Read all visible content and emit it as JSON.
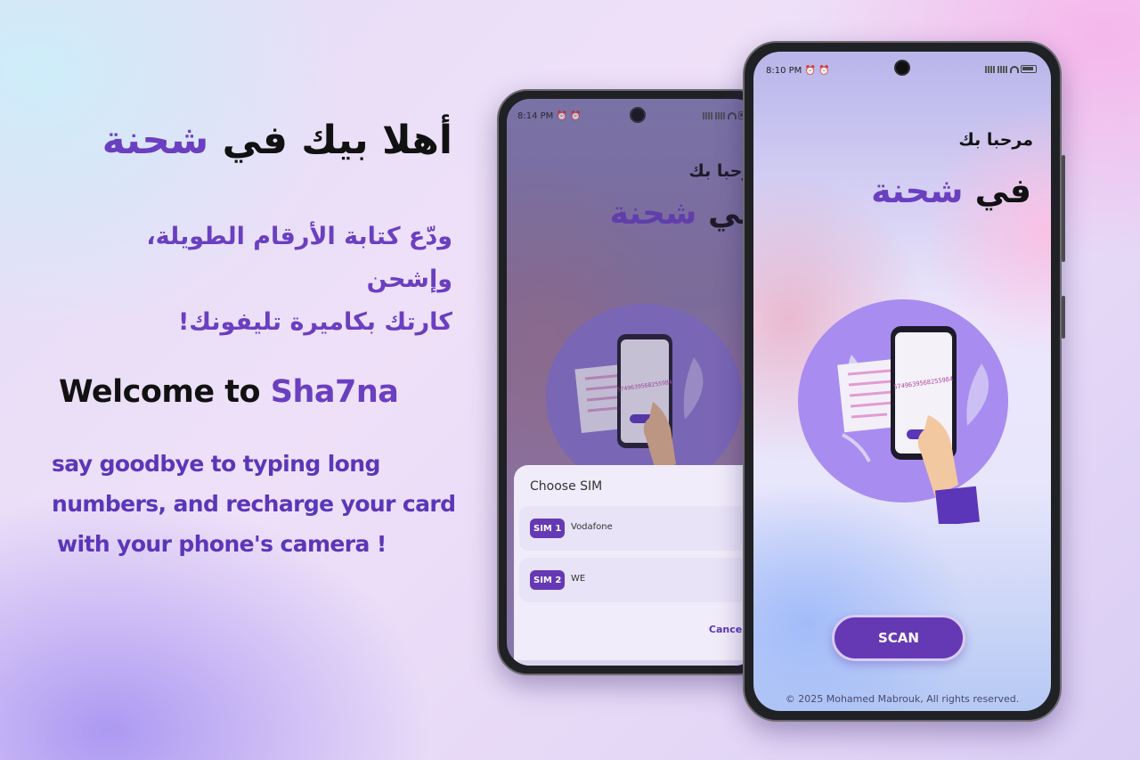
{
  "headline_ar": {
    "part1": "أهلا بيك في",
    "part2": "شحنة"
  },
  "subtitle_ar": {
    "line1": "ودّع كتابة الأرقام الطويلة، وإشحن",
    "line2": "كارتك بكاميرة تليفونك!"
  },
  "headline_en": {
    "part1": "Welcome to",
    "part2": "Sha7na"
  },
  "subtitle_en": {
    "line1": "say goodbye to typing long",
    "line2": "numbers, and recharge your card",
    "line3": "with your phone's camera !"
  },
  "back_phone": {
    "status_time": "8:14 PM",
    "welcome_line1": "مرحبا بك",
    "welcome_line2_prefix": "في",
    "welcome_line2_brand": "شحنة",
    "card_number": "5749639568255984",
    "sheet": {
      "title": "Choose SIM",
      "sims": [
        {
          "badge": "SIM 1",
          "name": "Vodafone"
        },
        {
          "badge": "SIM 2",
          "name": "WE"
        }
      ],
      "cancel_label": "Cancel"
    }
  },
  "front_phone": {
    "status_time": "8:10 PM",
    "welcome_line1": "مرحبا بك",
    "welcome_line2_prefix": "في",
    "welcome_line2_brand": "شحنة",
    "card_number": "5749639568255984",
    "scan_label": "SCAN",
    "copyright": "© 2025 Mohamed Mabrouk, All rights reserved."
  },
  "icons": {
    "alarm": "alarm-clock-icon",
    "signal": "signal-icon",
    "wifi": "wifi-icon",
    "battery": "battery-icon"
  },
  "colors": {
    "brand_purple": "#6539b4",
    "accent_text": "#6a3fc0",
    "circle_purple": "#a88cf0"
  }
}
